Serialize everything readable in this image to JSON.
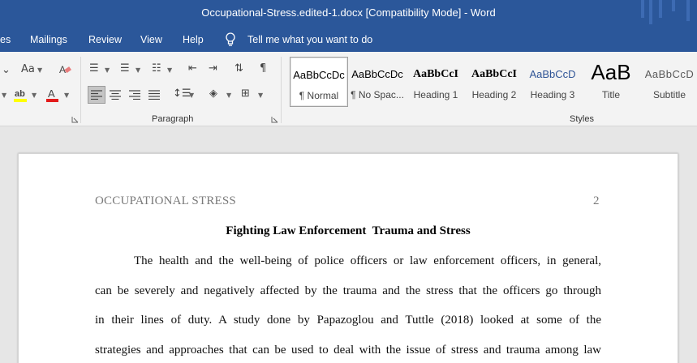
{
  "window": {
    "title": "Occupational-Stress.edited-1.docx [Compatibility Mode]  -  Word"
  },
  "menu": {
    "tabs": [
      "es",
      "Mailings",
      "Review",
      "View",
      "Help"
    ],
    "tell_me": "Tell me what you want to do"
  },
  "ribbon": {
    "font_group": {
      "change_case": "Aa",
      "highlight_color": "#ffff00",
      "font_color": "#e31b1b"
    },
    "paragraph_label": "Paragraph",
    "styles_label": "Styles",
    "styles": [
      {
        "sample": "AaBbCcDc",
        "name": "¶ Normal",
        "selected": true
      },
      {
        "sample": "AaBbCcDc",
        "name": "¶ No Spac..."
      },
      {
        "sample": "AaBbCcI",
        "name": "Heading 1"
      },
      {
        "sample": "AaBbCcI",
        "name": "Heading 2"
      },
      {
        "sample": "AaBbCcD",
        "name": "Heading 3"
      },
      {
        "sample": "AaB",
        "name": "Title"
      },
      {
        "sample": "AaBbCcD",
        "name": "Subtitle"
      }
    ]
  },
  "document": {
    "running_head": "OCCUPATIONAL STRESS",
    "page_number": "2",
    "title": "Fighting Law Enforcement  Trauma and Stress",
    "paragraph_lines": [
      "The health and the well-being of police officers or law enforcement officers, in general,",
      "can be severely and negatively affected by the trauma and the stress that the officers go through",
      "in their lines of duty. A study done by Papazoglou and Tuttle (2018) looked at some of the",
      "strategies and approaches that can be used to deal with the issue of stress and trauma among law"
    ]
  }
}
